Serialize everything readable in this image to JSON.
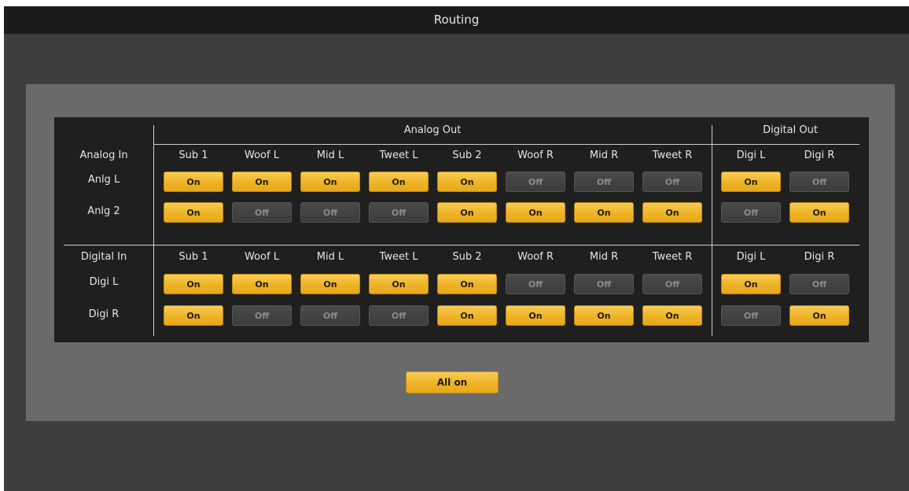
{
  "window": {
    "title": "Routing"
  },
  "groups": {
    "analog_out": "Analog Out",
    "digital_out": "Digital Out"
  },
  "outputs": [
    "Sub 1",
    "Woof L",
    "Mid L",
    "Tweet L",
    "Sub 2",
    "Woof R",
    "Mid R",
    "Tweet R",
    "Digi L",
    "Digi R"
  ],
  "sections": [
    {
      "header": "Analog In",
      "rows": [
        {
          "label": "Anlg L",
          "states": [
            "On",
            "On",
            "On",
            "On",
            "On",
            "Off",
            "Off",
            "Off",
            "On",
            "Off"
          ]
        },
        {
          "label": "Anlg 2",
          "states": [
            "On",
            "Off",
            "Off",
            "Off",
            "On",
            "On",
            "On",
            "On",
            "Off",
            "On"
          ]
        }
      ]
    },
    {
      "header": "Digital In",
      "rows": [
        {
          "label": "Digi L",
          "states": [
            "On",
            "On",
            "On",
            "On",
            "On",
            "Off",
            "Off",
            "Off",
            "On",
            "Off"
          ]
        },
        {
          "label": "Digi R",
          "states": [
            "On",
            "Off",
            "Off",
            "Off",
            "On",
            "On",
            "On",
            "On",
            "Off",
            "On"
          ]
        }
      ]
    }
  ],
  "all_on_label": "All on",
  "colors": {
    "on": "#eeb324",
    "off": "#3c3c3c",
    "background": "#3f3f3f",
    "panel": "#6a6a6a",
    "matrix": "#1f1f1f"
  }
}
